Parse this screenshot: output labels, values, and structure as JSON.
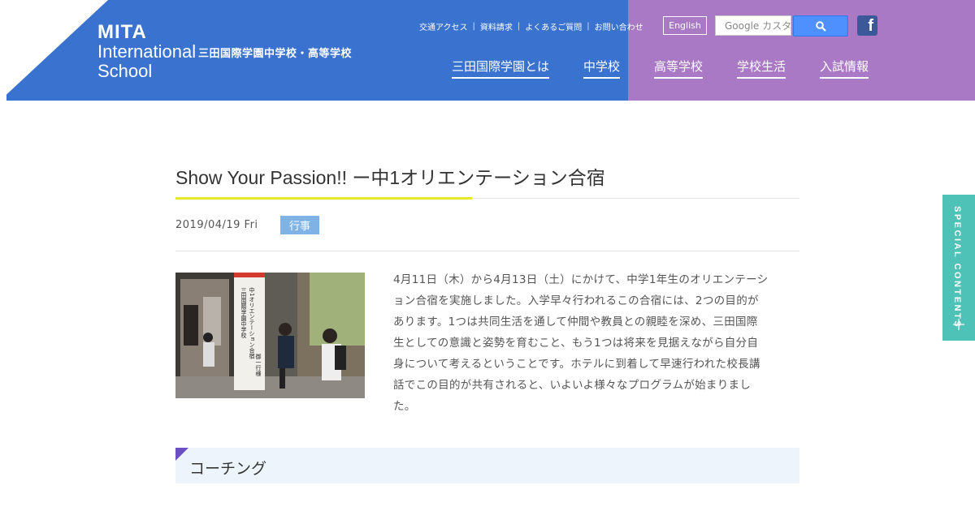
{
  "header": {
    "logo": {
      "line1": "MITA",
      "line2": "International",
      "line3": "School"
    },
    "school_name_jp": "三田国際学園中学校・高等学校",
    "util_nav": [
      "交通アクセス",
      "資料請求",
      "よくあるご質問",
      "お問い合わせ"
    ],
    "lang_button": "English",
    "search_placeholder": "Google カスタム検索",
    "search_icon": "magnifier-icon",
    "social_icon": "facebook-icon",
    "main_nav": [
      "三田国際学園とは",
      "中学校",
      "高等学校",
      "学校生活",
      "入試情報"
    ],
    "colors": {
      "blue": "#3a72cf",
      "purple": "#a979c6"
    }
  },
  "article": {
    "title": "Show Your Passion!! ー中1オリエンテーション合宿",
    "date": "2019/04/19 Fri",
    "category": "行事",
    "body_lines": [
      "4月11日（木）から4月13日（土）にかけて、中学1年生のオリエンテーシ",
      "ョン合宿を実施しました。入学早々行われるこの合宿には、2つの目的が",
      "あります。1つは共同生活を通して仲間や教員との親睦を深め、三田国際",
      "生としての意識と姿勢を育むこと、もう1つは将来を見据えながら自分自",
      "身について考えるということです。ホテルに到着して早速行われた校長講",
      "話でこの目的が共有されると、いよいよ様々なプログラムが始まりまし",
      "た。"
    ],
    "section_heading": "コーチング",
    "photo_sign_lines": [
      "三田国際学園中学校",
      "中1オリエンテーション合宿",
      "御一行様"
    ]
  },
  "side_tab": {
    "label": "SPECIAL CONTENTS",
    "icon": "plus-icon",
    "color": "#4fc2b7"
  }
}
